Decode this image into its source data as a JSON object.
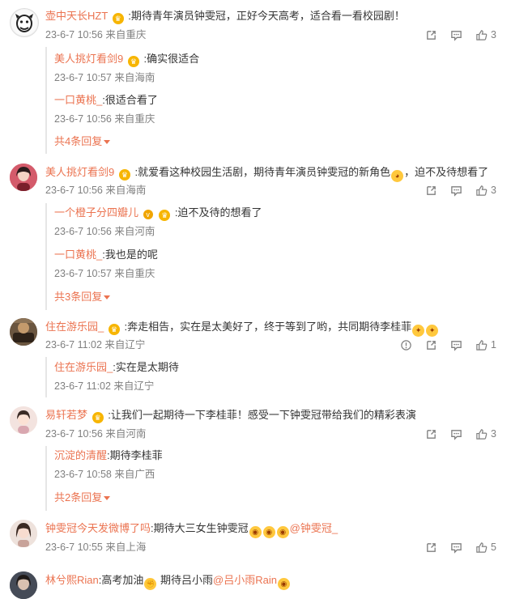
{
  "comments": [
    {
      "user": "壶中天长HZT",
      "text": ":期待青年演员钟雯冠，正好今天高考，适合看一看校园剧！",
      "time": "23-6-7 10:56 来自重庆",
      "likes": "3",
      "replies": [
        {
          "user": "美人挑灯看剑9",
          "text": ":确实很适合",
          "time": "23-6-7 10:57 来自海南"
        },
        {
          "user": "一口黄桃_",
          "text": ":很适合看了",
          "time": "23-6-7 10:56 来自重庆"
        }
      ],
      "more": "共4条回复"
    },
    {
      "user": "美人挑灯看剑9",
      "text_a": ":就爱看这种校园生活剧，期待青年演员钟雯冠的新角色",
      "text_b": "，迫不及待想看了",
      "time": "23-6-7 10:56 来自海南",
      "likes": "3",
      "replies": [
        {
          "user": "一个橙子分四瓣儿",
          "text": ":迫不及待的想看了",
          "time": "23-6-7 10:56 来自河南"
        },
        {
          "user": "一口黄桃_",
          "text": ":我也是的呢",
          "time": "23-6-7 10:57 来自重庆"
        }
      ],
      "more": "共3条回复"
    },
    {
      "user": "住在游乐园_",
      "text": ":奔走相告，实在是太美好了，终于等到了哟，共同期待李桂菲",
      "time": "23-6-7 11:02 来自辽宁",
      "likes": "1",
      "replies": [
        {
          "user": "住在游乐园_",
          "text": ":实在是太期待",
          "time": "23-6-7 11:02 来自辽宁"
        }
      ]
    },
    {
      "user": "易轩若梦",
      "text": ":让我们一起期待一下李桂菲！感受一下钟雯冠带给我们的精彩表演",
      "time": "23-6-7 10:56 来自河南",
      "likes": "3",
      "replies": [
        {
          "user": "沉淀的清醒",
          "text": ":期待李桂菲",
          "time": "23-6-7 10:58 来自广西"
        }
      ],
      "more": "共2条回复"
    },
    {
      "user": "钟雯冠今天发微博了吗",
      "text": ":期待大三女生钟雯冠",
      "mention": "@钟雯冠_",
      "time": "23-6-7 10:55 来自上海",
      "likes": "5"
    },
    {
      "user": "林兮熙Rian",
      "text_a": ":高考加油",
      "text_b": "期待吕小雨",
      "mention": "@吕小雨Rain"
    }
  ],
  "icons": {
    "crown": "crown-badge-icon",
    "share": "share-icon",
    "comment": "comment-icon",
    "like": "thumbs-up-icon",
    "report": "report-icon",
    "more": "chevron-down-icon"
  },
  "colors": {
    "username": "#eb7350",
    "meta": "#808080",
    "text": "#333333"
  }
}
